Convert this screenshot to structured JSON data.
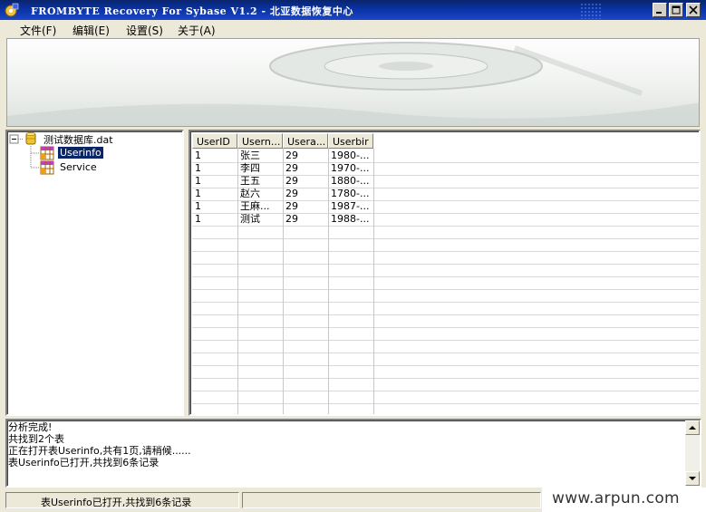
{
  "window": {
    "title": "FROMBYTE Recovery For Sybase V1.2 - 北亚数据恢复中心"
  },
  "menu": [
    {
      "label": "文件(F)"
    },
    {
      "label": "编辑(E)"
    },
    {
      "label": "设置(S)"
    },
    {
      "label": "关于(A)"
    }
  ],
  "tree": {
    "root": "测试数据库.dat",
    "children": [
      {
        "label": "Userinfo",
        "selected": true
      },
      {
        "label": "Service",
        "selected": false
      }
    ]
  },
  "table": {
    "columns": [
      "UserID",
      "Usern...",
      "Usera...",
      "Userbir"
    ],
    "rows": [
      [
        "1",
        "张三",
        "29",
        "1980-..."
      ],
      [
        "1",
        "李四",
        "29",
        "1970-..."
      ],
      [
        "1",
        "王五",
        "29",
        "1880-..."
      ],
      [
        "1",
        "赵六",
        "29",
        "1780-..."
      ],
      [
        "1",
        "王麻...",
        "29",
        "1987-..."
      ],
      [
        "1",
        "测试",
        "29",
        "1988-..."
      ]
    ]
  },
  "log": {
    "lines": [
      "分析完成!",
      "共找到2个表",
      "正在打开表Userinfo,共有1页,请稍候......",
      "表Userinfo已打开,共找到6条记录"
    ]
  },
  "statusbar": {
    "message": "表Userinfo已打开,共找到6条记录"
  },
  "watermark": "www.arpun.com",
  "colors": {
    "titlebar": "#0a246a",
    "selection": "#0a246a",
    "face": "#ece9d8"
  }
}
